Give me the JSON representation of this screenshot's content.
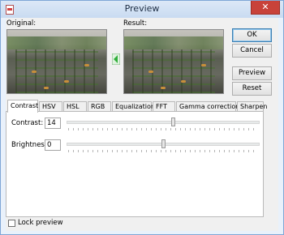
{
  "window": {
    "title": "Preview",
    "close_glyph": "✕"
  },
  "images": {
    "original_label": "Original:",
    "result_label": "Result:"
  },
  "buttons": {
    "ok": "OK",
    "cancel": "Cancel",
    "preview": "Preview",
    "reset": "Reset"
  },
  "tabs": [
    {
      "label": "Contrast",
      "active": true
    },
    {
      "label": "HSV"
    },
    {
      "label": "HSL"
    },
    {
      "label": "RGB"
    },
    {
      "label": "Equalization"
    },
    {
      "label": "FFT"
    },
    {
      "label": "Gamma correction"
    },
    {
      "label": "Sharpen"
    }
  ],
  "contrast_panel": {
    "contrast": {
      "label": "Contrast:",
      "value": "14",
      "slider_fraction": 0.55
    },
    "brightness": {
      "label": "Brightness:",
      "value": "0",
      "slider_fraction": 0.5
    }
  },
  "lock_preview": {
    "label": "Lock preview",
    "checked": false
  },
  "colors": {
    "accent": "#3c7fb1",
    "arrow": "#2fae3a",
    "close": "#c8423a"
  }
}
